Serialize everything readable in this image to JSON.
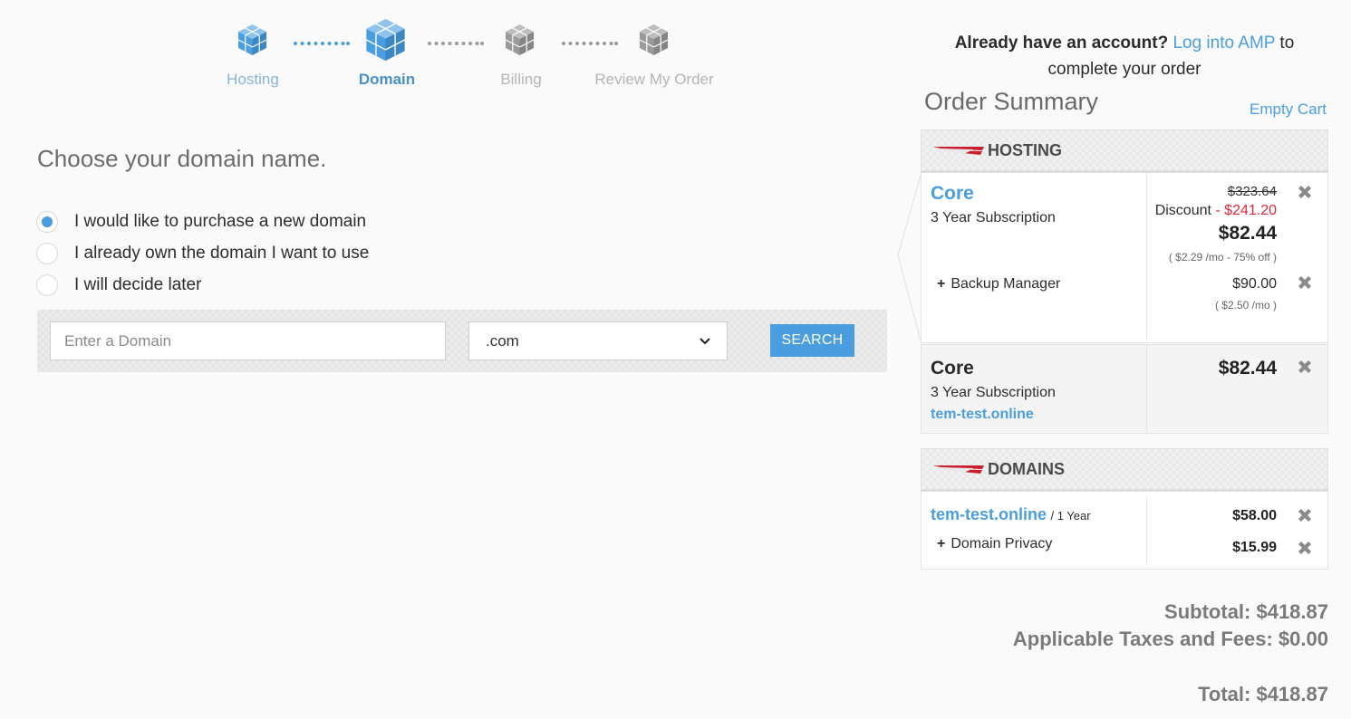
{
  "steps": [
    {
      "label": "Hosting",
      "state": "done"
    },
    {
      "label": "Domain",
      "state": "active"
    },
    {
      "label": "Billing",
      "state": "disabled"
    },
    {
      "label": "Review My Order",
      "state": "disabled"
    }
  ],
  "main": {
    "heading": "Choose your domain name.",
    "options": [
      {
        "label": "I would like to purchase a new domain",
        "checked": true
      },
      {
        "label": "I already own the domain I want to use",
        "checked": false
      },
      {
        "label": "I will decide later",
        "checked": false
      }
    ],
    "search": {
      "placeholder": "Enter a Domain",
      "tld": ".com",
      "button": "SEARCH"
    }
  },
  "account": {
    "question": "Already have an account?",
    "link": "Log into AMP",
    "suffix": "to",
    "line2": "complete your order"
  },
  "summary": {
    "title": "Order Summary",
    "empty_cart": "Empty Cart",
    "hosting": {
      "section_title": "HOSTING",
      "item": {
        "name": "Core",
        "term": "3 Year Subscription",
        "original_price": "$323.64",
        "discount_label": "Discount",
        "discount_value": "- $241.20",
        "price": "$82.44",
        "monthly": "( $2.29 /mo - 75% off )"
      },
      "addon": {
        "plus": "+",
        "name": "Backup Manager",
        "price": "$90.00",
        "monthly": "( $2.50 /mo )"
      },
      "selected": {
        "name": "Core",
        "term": "3 Year Subscription",
        "domain": "tem-test.online",
        "price": "$82.44"
      }
    },
    "domains": {
      "section_title": "DOMAINS",
      "item": {
        "name": "tem-test.online",
        "term": "/ 1 Year",
        "price": "$58.00"
      },
      "addon": {
        "plus": "+",
        "name": "Domain Privacy",
        "price": "$15.99"
      }
    },
    "subtotal": "Subtotal: $418.87",
    "taxes": "Applicable Taxes and Fees: $0.00",
    "total": "Total: $418.87"
  },
  "colors": {
    "accent": "#4a9ee0",
    "discount": "#e0283c",
    "flag": "#c8202f"
  }
}
